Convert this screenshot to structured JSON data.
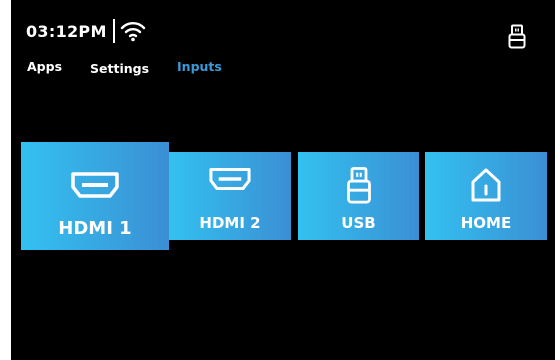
{
  "status": {
    "time": "03:12PM",
    "wifi_icon": "wifi-icon",
    "usb_icon": "usb-drive-icon"
  },
  "nav": {
    "tabs": [
      {
        "label": "Apps",
        "active": false
      },
      {
        "label": "Settings",
        "active": false
      },
      {
        "label": "Inputs",
        "active": true
      }
    ]
  },
  "inputs": {
    "tiles": [
      {
        "label": "HDMI 1",
        "icon": "hdmi-port-icon",
        "selected": true
      },
      {
        "label": "HDMI 2",
        "icon": "hdmi-port-icon",
        "selected": false
      },
      {
        "label": "USB",
        "icon": "usb-drive-icon",
        "selected": false
      },
      {
        "label": "HOME",
        "icon": "home-icon",
        "selected": false
      }
    ]
  },
  "colors": {
    "background": "#000000",
    "active_tab": "#3a9ad9",
    "tile_gradient_start": "#33c1f0",
    "tile_gradient_end": "#3b8fd4"
  }
}
